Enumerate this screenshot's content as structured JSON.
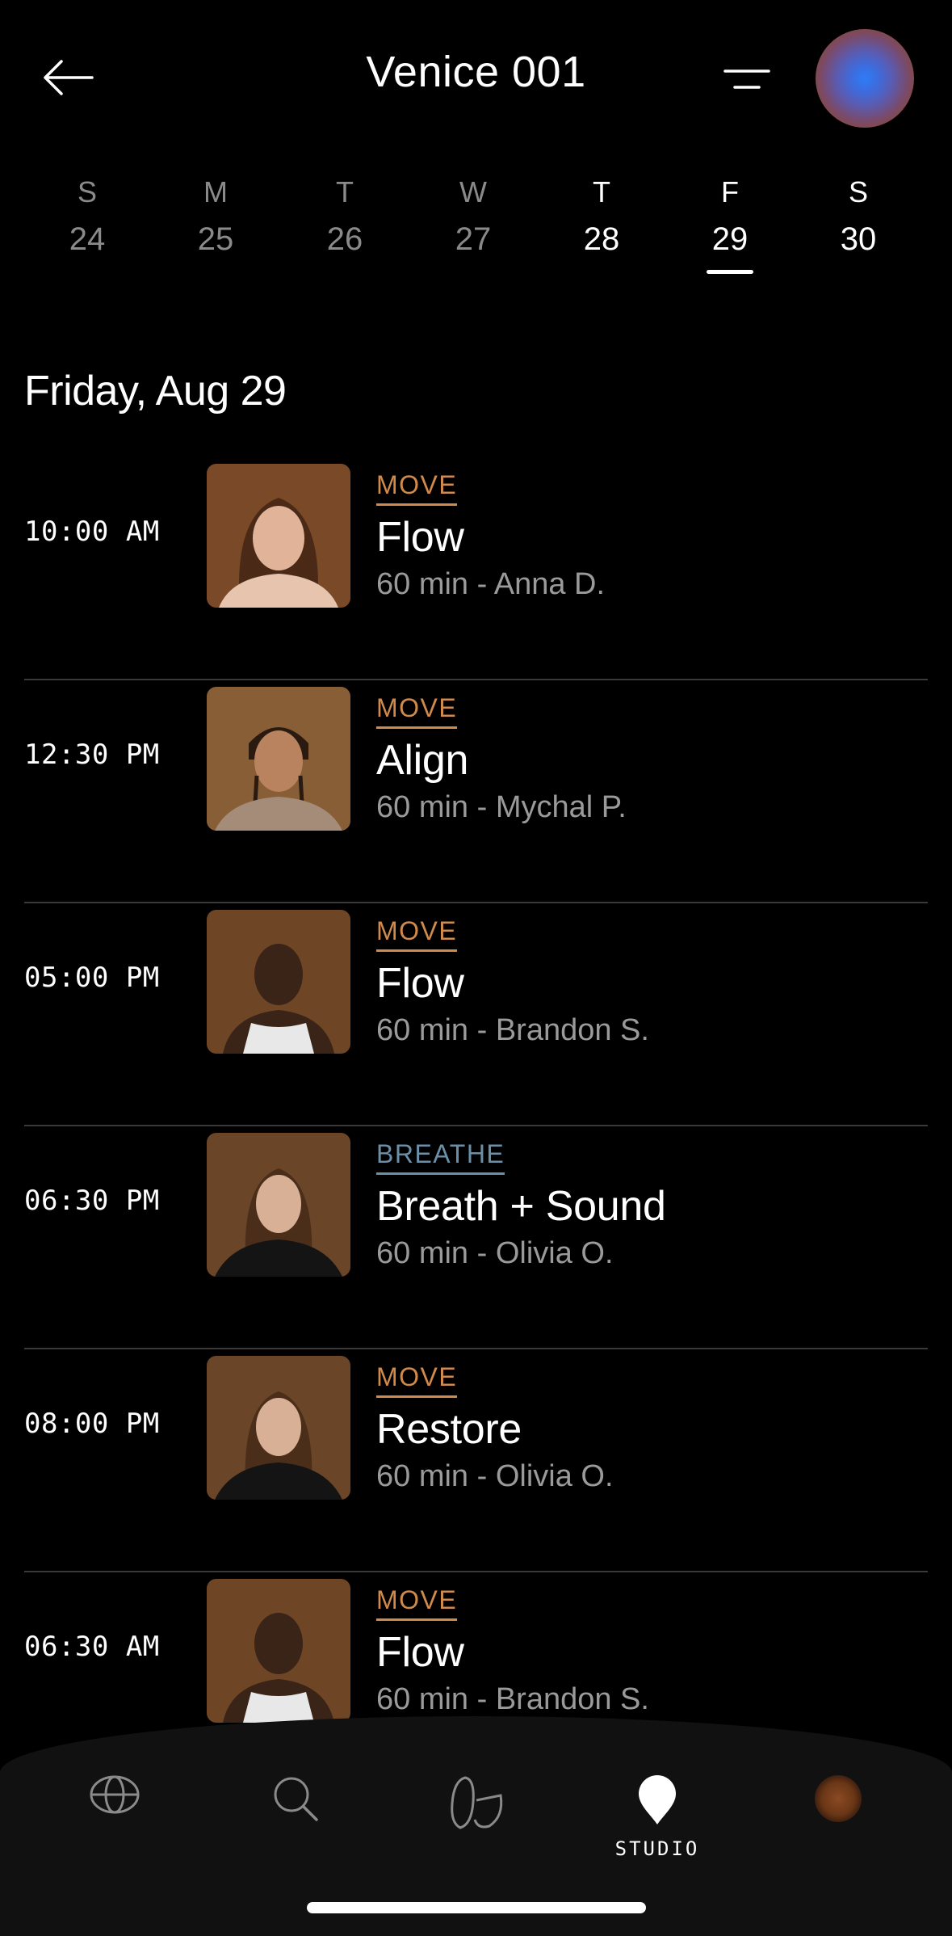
{
  "header": {
    "title": "Venice 001",
    "back_icon": "arrow-left-icon",
    "menu_icon": "filter-lines-icon"
  },
  "week": [
    {
      "dow": "S",
      "num": "24",
      "active": false,
      "selected": false
    },
    {
      "dow": "M",
      "num": "25",
      "active": false,
      "selected": false
    },
    {
      "dow": "T",
      "num": "26",
      "active": false,
      "selected": false
    },
    {
      "dow": "W",
      "num": "27",
      "active": false,
      "selected": false
    },
    {
      "dow": "T",
      "num": "28",
      "active": true,
      "selected": false
    },
    {
      "dow": "F",
      "num": "29",
      "active": true,
      "selected": true
    },
    {
      "dow": "S",
      "num": "30",
      "active": true,
      "selected": false
    }
  ],
  "date_heading": "Friday, Aug 29",
  "classes": [
    {
      "time": "10:00 AM",
      "category": "MOVE",
      "name": "Flow",
      "meta": "60 min - Anna D."
    },
    {
      "time": "12:30 PM",
      "category": "MOVE",
      "name": "Align",
      "meta": "60 min - Mychal P."
    },
    {
      "time": "05:00 PM",
      "category": "MOVE",
      "name": "Flow",
      "meta": "60 min - Brandon S."
    },
    {
      "time": "06:30 PM",
      "category": "BREATHE",
      "name": "Breath + Sound",
      "meta": "60 min - Olivia O."
    },
    {
      "time": "08:00 PM",
      "category": "MOVE",
      "name": "Restore",
      "meta": "60 min - Olivia O."
    },
    {
      "time": "06:30 AM",
      "category": "MOVE",
      "name": "Flow",
      "meta": "60 min - Brandon S."
    }
  ],
  "colors": {
    "move": "#d08a4c",
    "breathe": "#6c8fa8",
    "background": "#000000",
    "muted_text": "#9a9a9a"
  },
  "tabbar": {
    "tabs": [
      {
        "icon": "globe-icon",
        "label": ""
      },
      {
        "icon": "search-icon",
        "label": ""
      },
      {
        "icon": "stones-icon",
        "label": ""
      },
      {
        "icon": "location-pin-icon",
        "label": "STUDIO"
      },
      {
        "icon": "profile-avatar-icon",
        "label": ""
      }
    ]
  }
}
